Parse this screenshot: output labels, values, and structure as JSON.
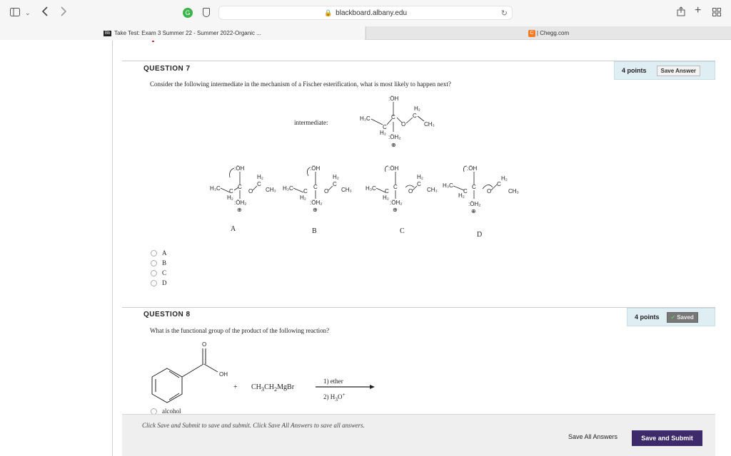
{
  "browser": {
    "url": "blackboard.albany.edu",
    "tabs": [
      {
        "favicon": "Bb",
        "label": "Take Test: Exam 3 Summer 22 - Summer 2022-Organic ..."
      },
      {
        "favicon": "C",
        "label": "| Chegg.com"
      }
    ],
    "icons": [
      "sidebar-icon",
      "chevron-down-icon",
      "back-icon",
      "forward-icon",
      "grammarly-icon",
      "privacy-icon",
      "lock-icon",
      "reload-icon",
      "share-icon",
      "new-tab-icon",
      "tab-overview-icon"
    ]
  },
  "q7": {
    "title": "QUESTION 7",
    "points": "4 points",
    "button": "Save Answer",
    "text": "Consider the following intermediate in the mechanism of a Fischer esterification, what is most likely to happen next?",
    "intermediate_label": "intermediate:",
    "option_labels": [
      "A",
      "B",
      "C",
      "D"
    ],
    "choices": [
      "A",
      "B",
      "C",
      "D"
    ]
  },
  "q8": {
    "title": "QUESTION 8",
    "points": "4 points",
    "button": "Saved",
    "text": "What is the functional group of the product of the following reaction?",
    "plus": "+",
    "reagent": "CH3CH2MgBr",
    "step1": "1) ether",
    "step2": "2) H3O+",
    "choice": "alcohol"
  },
  "footer": {
    "note": "Click Save and Submit to save and submit. Click Save All Answers to save all answers.",
    "save_all": "Save All Answers",
    "save_submit": "Save and Submit"
  }
}
